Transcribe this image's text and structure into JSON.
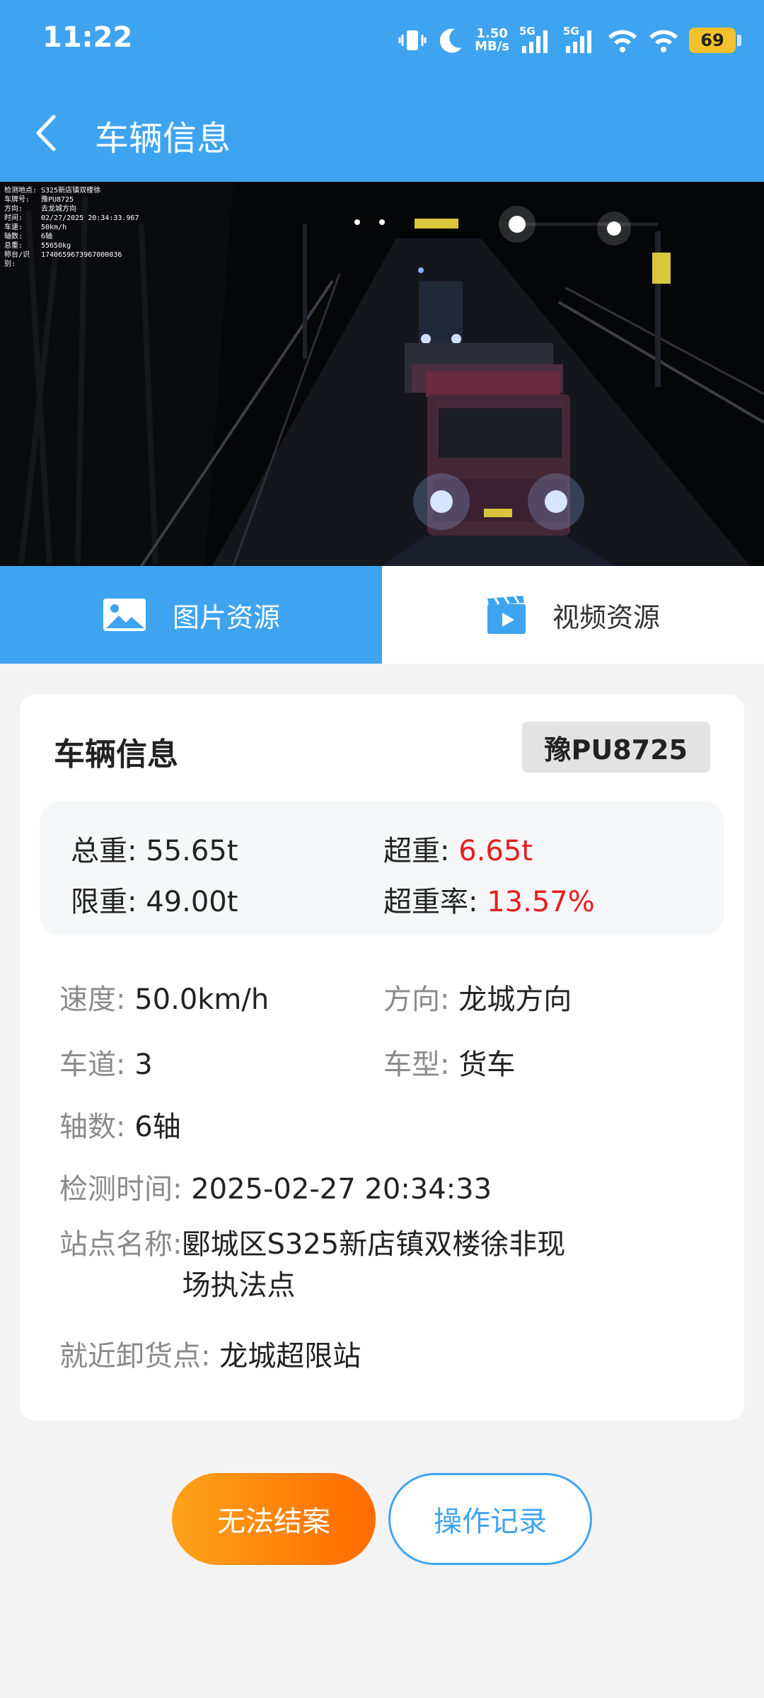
{
  "status_bar": {
    "time": "11:22",
    "net_speed_value": "1.50",
    "net_speed_unit": "MB/s",
    "signal1_label": "5G",
    "signal2_label": "5G",
    "battery": "69",
    "icons": [
      "vibrate-icon",
      "moon-icon",
      "signal-icon",
      "signal-icon",
      "wifi-icon",
      "wifi-icon",
      "battery-icon"
    ]
  },
  "header": {
    "title": "车辆信息",
    "back_icon": "chevron-left-icon"
  },
  "photo_overlay": [
    {
      "k": "检测地点:",
      "v": "S325新店镇双楼徐"
    },
    {
      "k": "车牌号:",
      "v": "豫PU8725"
    },
    {
      "k": "方向:",
      "v": "去龙城方向"
    },
    {
      "k": "时间:",
      "v": "02/27/2025 20:34:33.967"
    },
    {
      "k": "车速:",
      "v": "50km/h"
    },
    {
      "k": "轴数:",
      "v": "6轴"
    },
    {
      "k": "总重:",
      "v": "55650kg"
    },
    {
      "k": "称台/识别:",
      "v": "1740659673967000036"
    }
  ],
  "tabs": [
    {
      "label": "图片资源",
      "icon": "image-icon",
      "active": true
    },
    {
      "label": "视频资源",
      "icon": "video-icon",
      "active": false
    }
  ],
  "card": {
    "title": "车辆信息",
    "plate": "豫PU8725",
    "total_weight_label": "总重: ",
    "total_weight": "55.65t",
    "over_weight_label": "超重: ",
    "over_weight": "6.65t",
    "limit_weight_label": "限重: ",
    "limit_weight": "49.00t",
    "over_rate_label": "超重率: ",
    "over_rate": "13.57%",
    "speed_label": "速度: ",
    "speed": "50.0km/h",
    "direction_label": "方向: ",
    "direction": "龙城方向",
    "lane_label": "车道: ",
    "lane": "3",
    "vehicle_type_label": "车型: ",
    "vehicle_type": "货车",
    "axles_label": "轴数: ",
    "axles": "6轴",
    "detect_time_label": "检测时间: ",
    "detect_time": "2025-02-27 20:34:33",
    "station_label": "站点名称: ",
    "station": "郾城区S325新店镇双楼徐非现场执法点",
    "unload_label": "就近卸货点: ",
    "unload": "龙城超限站"
  },
  "actions": {
    "close_case": "无法结案",
    "operation_log": "操作记录"
  },
  "colors": {
    "primary": "#3fa4f0",
    "danger": "#e81c1c",
    "accent_start": "#ffa31a",
    "accent_end": "#ff6a00"
  }
}
